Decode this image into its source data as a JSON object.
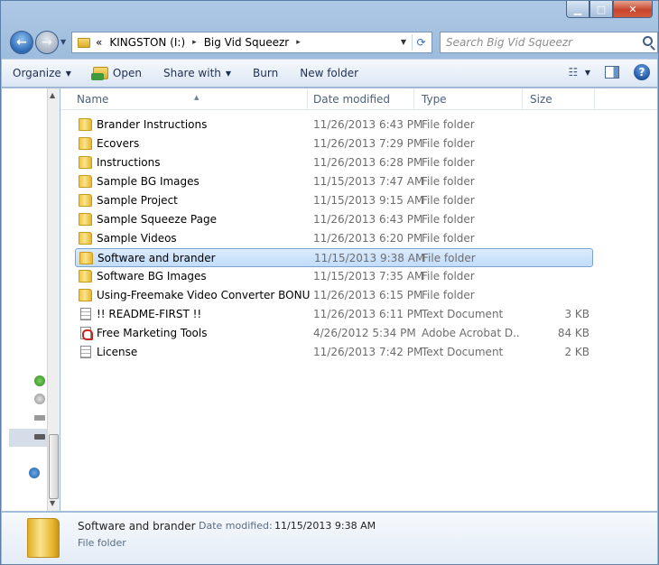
{
  "window": {
    "caption_buttons": {
      "minimize": "▁",
      "maximize": "□",
      "close": "✕"
    }
  },
  "address": {
    "prefix": "«",
    "crumbs": [
      "KINGSTON (I:)",
      "Big Vid Squeezr"
    ],
    "separator": "▸"
  },
  "search": {
    "placeholder": "Search Big Vid Squeezr"
  },
  "toolbar": {
    "organize": "Organize",
    "open": "Open",
    "share_with": "Share with",
    "burn": "Burn",
    "new_folder": "New folder",
    "help": "?"
  },
  "columns": {
    "name": "Name",
    "date": "Date modified",
    "type": "Type",
    "size": "Size"
  },
  "files": [
    {
      "name": "Brander Instructions",
      "date": "11/26/2013 6:43 PM",
      "type": "File folder",
      "size": "",
      "icon": "folder-icon"
    },
    {
      "name": "Ecovers",
      "date": "11/26/2013 7:29 PM",
      "type": "File folder",
      "size": "",
      "icon": "folder-icon"
    },
    {
      "name": "Instructions",
      "date": "11/26/2013 6:28 PM",
      "type": "File folder",
      "size": "",
      "icon": "folder-icon"
    },
    {
      "name": "Sample BG Images",
      "date": "11/15/2013 7:47 AM",
      "type": "File folder",
      "size": "",
      "icon": "folder-icon"
    },
    {
      "name": "Sample Project",
      "date": "11/15/2013 9:15 AM",
      "type": "File folder",
      "size": "",
      "icon": "folder-icon"
    },
    {
      "name": "Sample Squeeze Page",
      "date": "11/26/2013 6:43 PM",
      "type": "File folder",
      "size": "",
      "icon": "folder-icon"
    },
    {
      "name": "Sample Videos",
      "date": "11/26/2013 6:20 PM",
      "type": "File folder",
      "size": "",
      "icon": "folder-icon"
    },
    {
      "name": "Software and brander",
      "date": "11/15/2013 9:38 AM",
      "type": "File folder",
      "size": "",
      "icon": "folder-icon",
      "selected": true
    },
    {
      "name": "Software BG Images",
      "date": "11/15/2013 7:35 AM",
      "type": "File folder",
      "size": "",
      "icon": "folder-icon"
    },
    {
      "name": "Using-Freemake Video Converter  BONUS",
      "date": "11/26/2013 6:15 PM",
      "type": "File folder",
      "size": "",
      "icon": "folder-icon"
    },
    {
      "name": "!! README-FIRST !!",
      "date": "11/26/2013 6:11 PM",
      "type": "Text Document",
      "size": "3 KB",
      "icon": "text-icon"
    },
    {
      "name": "Free Marketing Tools",
      "date": "4/26/2012 5:34 PM",
      "type": "Adobe Acrobat D...",
      "size": "84 KB",
      "icon": "pdf-icon"
    },
    {
      "name": "License",
      "date": "11/26/2013 7:42 PM",
      "type": "Text Document",
      "size": "2 KB",
      "icon": "text-icon"
    }
  ],
  "details": {
    "name": "Software and brander",
    "date_label": "Date modified:",
    "date_value": "11/15/2013 9:38 AM",
    "type": "File folder"
  }
}
